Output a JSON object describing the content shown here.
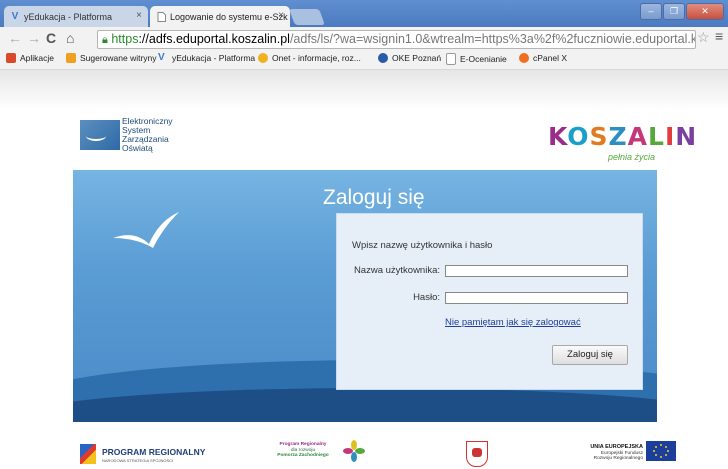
{
  "browser": {
    "tabs": [
      {
        "title": "yEdukacja - Platforma",
        "active": false,
        "favicon": "v-logo-icon"
      },
      {
        "title": "Logowanie do systemu e-Szk",
        "active": true,
        "favicon": "page-icon"
      }
    ],
    "url": {
      "scheme": "https",
      "host": "://adfs.eduportal.koszalin.pl",
      "path": "/adfs/ls/?wa=wsignin1.0&wtrealm=https%3a%2f%2fuczniowie.eduportal.koszali"
    },
    "bookmarks": [
      {
        "label": "Aplikacje",
        "icon": "apps-grid-icon",
        "color": "#d94a2b"
      },
      {
        "label": "Sugerowane witryny",
        "icon": "suggested-icon",
        "color": "#f0a020"
      },
      {
        "label": "yEdukacja - Platforma",
        "icon": "v-logo-icon",
        "color": "#3c7ad0"
      },
      {
        "label": "Onet - informacje, roz...",
        "icon": "onet-icon",
        "color": "#f0b020"
      },
      {
        "label": "OKE Poznań",
        "icon": "oke-icon",
        "color": "#2a5ba8"
      },
      {
        "label": "E-Ocenianie",
        "icon": "page-icon",
        "color": "#cccccc"
      },
      {
        "label": "cPanel X",
        "icon": "cpanel-icon",
        "color": "#f07020"
      }
    ]
  },
  "header": {
    "eszo_lines": [
      "Elektroniczny",
      "System",
      "Zarządzania",
      "Oświatą"
    ],
    "city_logo_letters": [
      "K",
      "O",
      "S",
      "Z",
      "A",
      "L",
      "I",
      "N"
    ],
    "city_tagline": "pełnia życia"
  },
  "login": {
    "title": "Zaloguj się",
    "prompt": "Wpisz nazwę użytkownika i hasło",
    "username_label": "Nazwa użytkownika:",
    "username_value": "",
    "password_label": "Hasło:",
    "password_value": "",
    "forgot_link": "Nie pamiętam jak się zalogować",
    "submit_label": "Zaloguj się"
  },
  "footer": {
    "program_title": "PROGRAM REGIONALNY",
    "program_sub": "NARODOWA STRATEGIA SPÓJNOŚCI",
    "pomorze_lines": [
      "Program Regionalny",
      "dla rozwoju",
      "Pomorza Zachodniego"
    ],
    "ue_lines": [
      "UNIA EUROPEJSKA",
      "Europejski Fundusz",
      "Rozwoju Regionalnego"
    ]
  },
  "colors": {
    "banner": "#5a9cd4",
    "panel": "#e6eff8",
    "link": "#1f3f99",
    "titlebar": "#5f8fd0"
  }
}
